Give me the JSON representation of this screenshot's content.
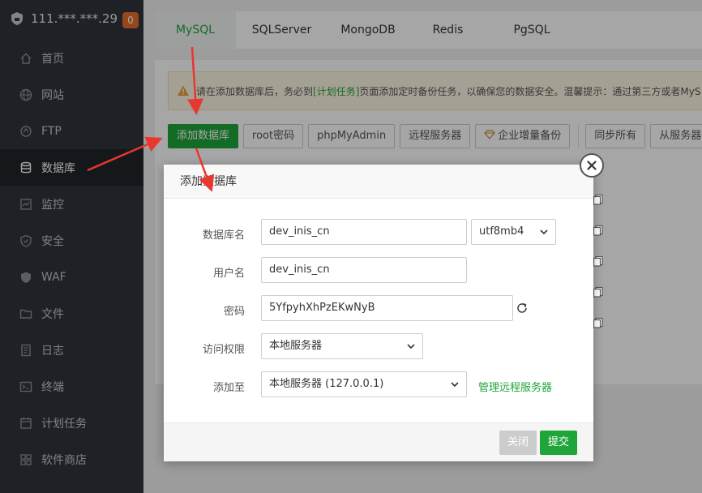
{
  "server": {
    "ip": "111.***.***.29",
    "badge": "0"
  },
  "sidebar": {
    "items": [
      {
        "label": "首页",
        "icon": "home-icon"
      },
      {
        "label": "网站",
        "icon": "globe-icon"
      },
      {
        "label": "FTP",
        "icon": "ftp-icon"
      },
      {
        "label": "数据库",
        "icon": "database-icon"
      },
      {
        "label": "监控",
        "icon": "monitor-icon"
      },
      {
        "label": "安全",
        "icon": "shield-icon"
      },
      {
        "label": "WAF",
        "icon": "waf-shield-icon"
      },
      {
        "label": "文件",
        "icon": "folder-icon"
      },
      {
        "label": "日志",
        "icon": "log-icon"
      },
      {
        "label": "终端",
        "icon": "terminal-icon"
      },
      {
        "label": "计划任务",
        "icon": "task-icon"
      },
      {
        "label": "软件商店",
        "icon": "grid-icon"
      }
    ]
  },
  "tabs": [
    "MySQL",
    "SQLServer",
    "MongoDB",
    "Redis",
    "PgSQL"
  ],
  "alert": {
    "before": "请在添加数据库后，务必到",
    "link": "[计划任务]",
    "after": "页面添加定时备份任务，以确保您的数据安全。温馨提示：通过第三方或者MyS"
  },
  "toolbar": {
    "add_db": "添加数据库",
    "root_pwd": "root密码",
    "phpmyadmin": "phpMyAdmin",
    "remote_server": "远程服务器",
    "enterprise_backup": "企业增量备份",
    "sync_all": "同步所有",
    "fetch_from_server": "从服务器获取"
  },
  "dialog": {
    "title": "添加数据库",
    "db_name_label": "数据库名",
    "db_name_value": "dev_inis_cn",
    "charset_value": "utf8mb4",
    "username_label": "用户名",
    "username_value": "dev_inis_cn",
    "password_label": "密码",
    "password_value": "5YfpyhXhPzEKwNyB",
    "access_label": "访问权限",
    "access_value": "本地服务器",
    "add_to_label": "添加至",
    "add_to_value": "本地服务器 (127.0.0.1)",
    "manage_remote": "管理远程服务器",
    "close_btn": "关闭",
    "submit_btn": "提交"
  },
  "colors": {
    "accent": "#20a53a",
    "sidebar_bg": "#2e3439",
    "badge": "#e96d2c",
    "arrow": "#e8372e"
  }
}
